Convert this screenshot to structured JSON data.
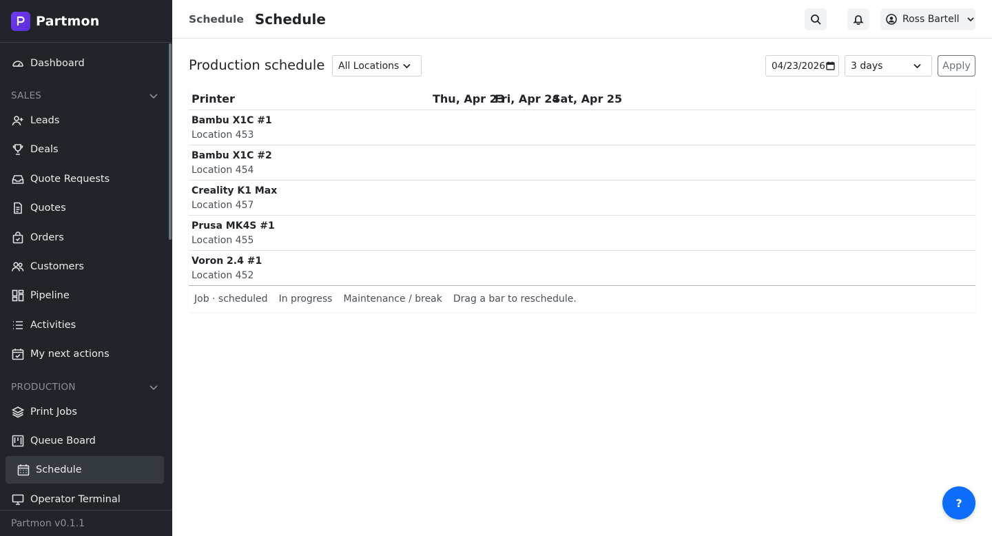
{
  "brand": {
    "name": "Partmon",
    "logo_letter": "P",
    "logo_color": "#6f3cf0"
  },
  "sidebar": {
    "dashboard": "Dashboard",
    "sales_section": "SALES",
    "sales_items": [
      {
        "label": "Leads",
        "icon": "user-plus-icon"
      },
      {
        "label": "Deals",
        "icon": "trophy-icon"
      },
      {
        "label": "Quote Requests",
        "icon": "inbox-icon"
      },
      {
        "label": "Quotes",
        "icon": "document-icon"
      },
      {
        "label": "Orders",
        "icon": "bag-icon"
      },
      {
        "label": "Customers",
        "icon": "people-icon"
      },
      {
        "label": "Pipeline",
        "icon": "kanban-icon"
      },
      {
        "label": "Activities",
        "icon": "list-icon"
      },
      {
        "label": "My next actions",
        "icon": "calendar-check-icon"
      }
    ],
    "production_section": "PRODUCTION",
    "production_items": [
      {
        "label": "Print Jobs",
        "icon": "layers-icon"
      },
      {
        "label": "Queue Board",
        "icon": "board-icon"
      },
      {
        "label": "Schedule",
        "icon": "calendar-icon",
        "active": true
      },
      {
        "label": "Operator Terminal",
        "icon": "monitor-icon"
      }
    ],
    "version": "Partmon v0.1.1"
  },
  "header": {
    "breadcrumb": "Schedule",
    "title": "Schedule",
    "user_name": "Ross Bartell"
  },
  "toolbar": {
    "title": "Production schedule",
    "location_select": "All Locations",
    "date_value": "04/23/2026",
    "range_select": "3 days",
    "apply_label": "Apply"
  },
  "schedule": {
    "printer_header": "Printer",
    "days": [
      "Thu, Apr 23",
      "Fri, Apr 24",
      "Sat, Apr 25"
    ],
    "printers": [
      {
        "name": "Bambu X1C #1",
        "location": "Location 453"
      },
      {
        "name": "Bambu X1C #2",
        "location": "Location 454"
      },
      {
        "name": "Creality K1 Max",
        "location": "Location 457"
      },
      {
        "name": "Prusa MK4S #1",
        "location": "Location 455"
      },
      {
        "name": "Voron 2.4 #1",
        "location": "Location 452"
      }
    ],
    "legend": [
      "Job · scheduled",
      "In progress",
      "Maintenance / break",
      "Drag a bar to reschedule."
    ]
  },
  "help_label": "?"
}
